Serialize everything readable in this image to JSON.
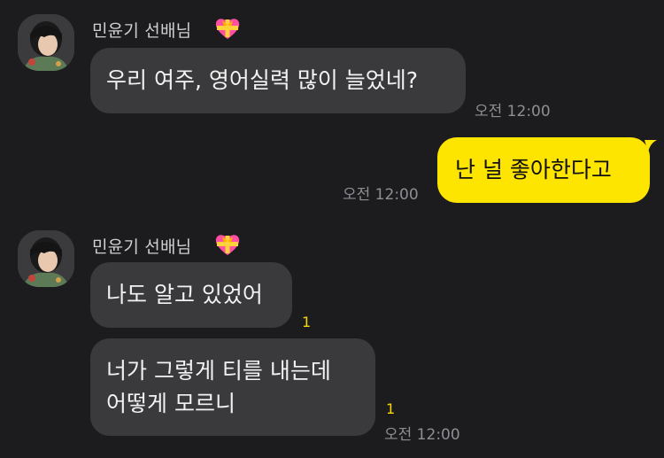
{
  "messages": [
    {
      "sender": "민윤기 선배님",
      "text": "우리 여주, 영어실력 많이 늘었네?",
      "time": "오전 12:00"
    },
    {
      "sender": "me",
      "text": "난 널 좋아한다고",
      "time": "오전 12:00"
    },
    {
      "sender": "민윤기 선배님",
      "group": [
        {
          "text": "나도 알고 있었어",
          "unread": "1"
        },
        {
          "text": "너가 그렇게 티를 내는데\n어떻게 모르니",
          "unread": "1",
          "time": "오전 12:00"
        }
      ]
    }
  ],
  "icons": {
    "sender_badge": "heart-ribbon-icon",
    "avatar": "profile-avatar"
  },
  "colors": {
    "background": "#1c1c1e",
    "incoming_bubble": "#3a3a3c",
    "outgoing_bubble": "#fee500",
    "unread": "#f7d700"
  }
}
